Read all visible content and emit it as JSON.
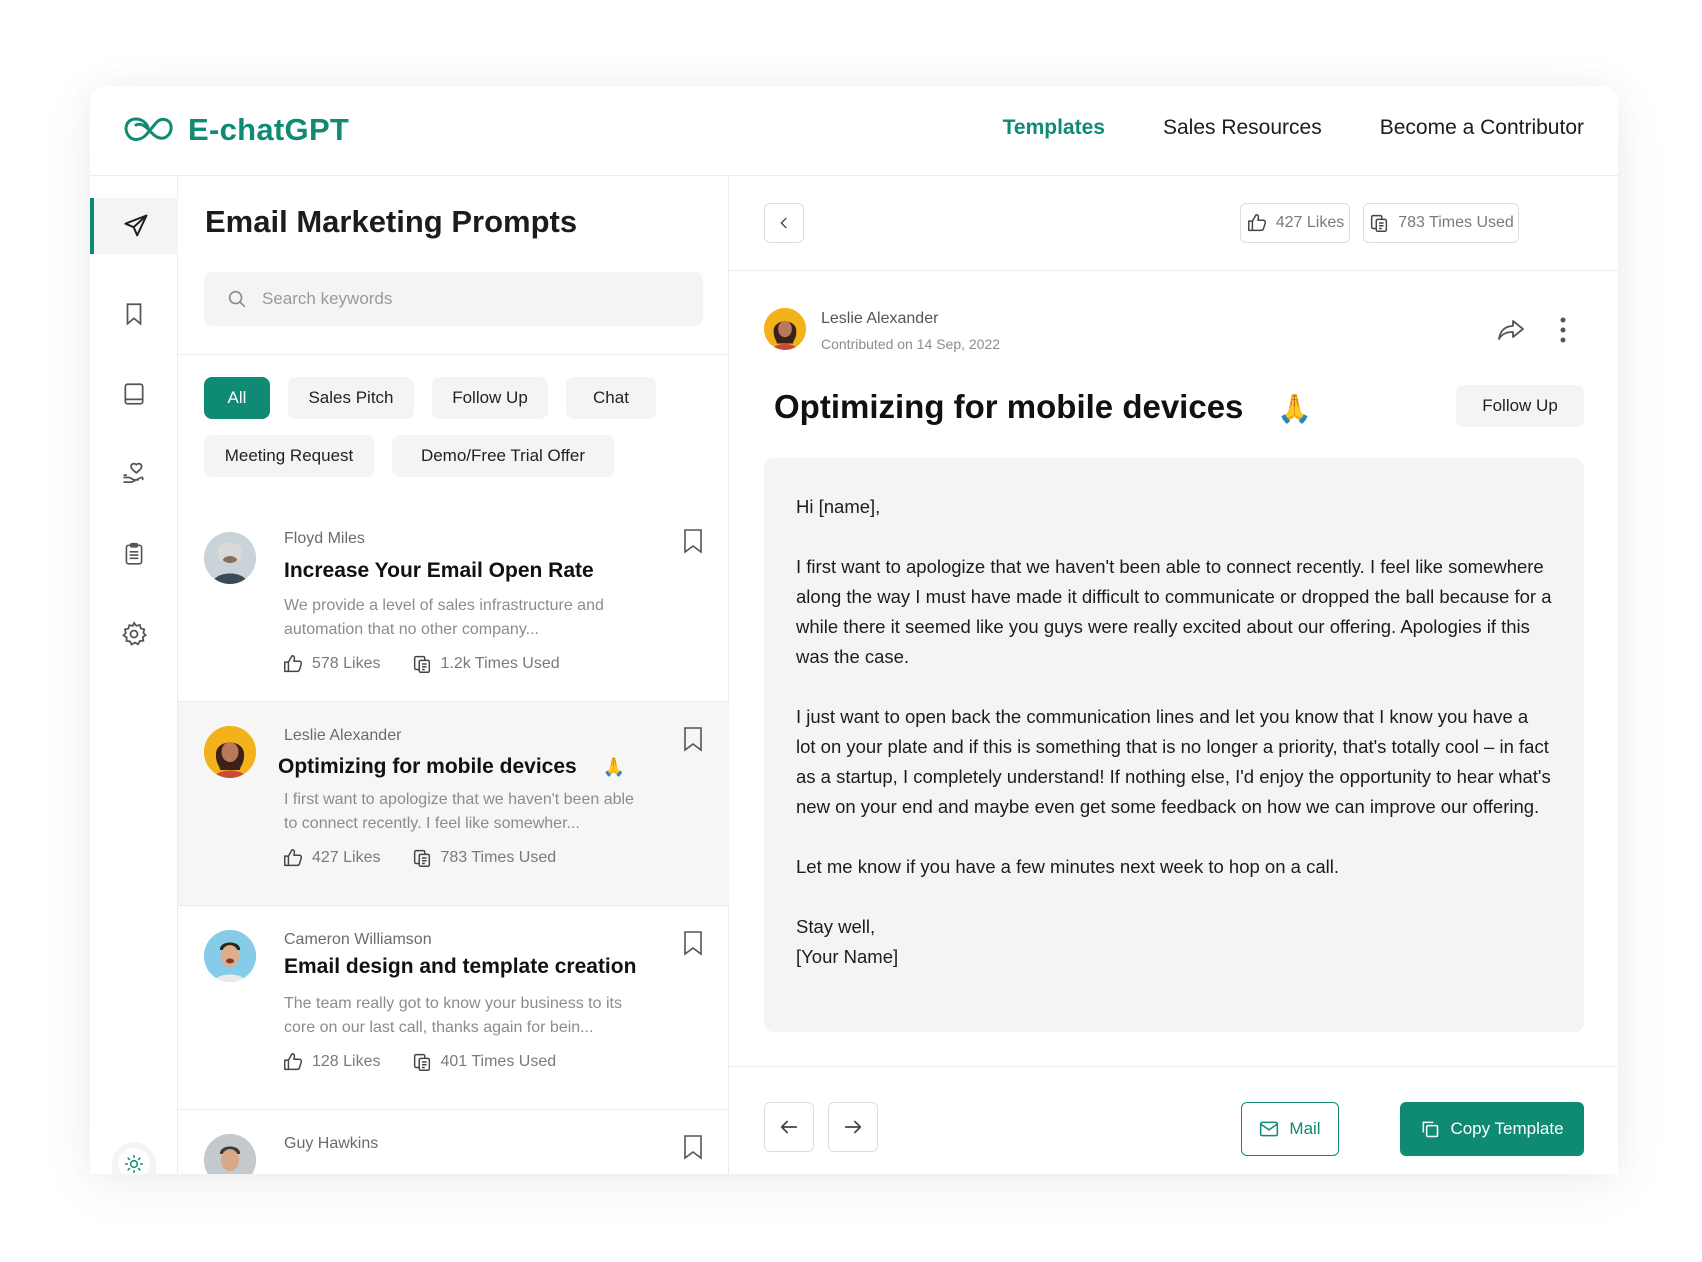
{
  "app": {
    "name": "E-chatGPT",
    "brand_color": "#0f8a73"
  },
  "nav": {
    "items": [
      "Templates",
      "Sales Resources",
      "Become a Contributor"
    ],
    "active": "Templates"
  },
  "rail": {
    "icons": [
      "send-icon",
      "bookmark-icon",
      "book-icon",
      "hand-heart-icon",
      "clipboard-icon",
      "settings-icon"
    ],
    "active": "send-icon",
    "theme": [
      "sun-icon",
      "moon-icon"
    ]
  },
  "list": {
    "title": "Email Marketing Prompts",
    "search_placeholder": "Search keywords",
    "filters": [
      "All",
      "Sales Pitch",
      "Follow Up",
      "Chat",
      "Meeting Request",
      "Demo/Free Trial Offer"
    ],
    "active_filter": "All",
    "cards": [
      {
        "author": "Floyd Miles",
        "title": "Increase Your Email Open Rate",
        "desc": "We provide a level of sales infrastructure and automation that no other company...",
        "likes": "578 Likes",
        "used": "1.2k Times Used"
      },
      {
        "author": "Leslie Alexander",
        "title": "Optimizing for mobile devices",
        "emoji": "🙏",
        "desc": "I first want to apologize that we haven't been able to connect recently. I feel like somewher...",
        "likes": "427 Likes",
        "used": "783 Times Used"
      },
      {
        "author": "Cameron Williamson",
        "title": "Email design and template creation",
        "desc": "The team really got to know your business to its core on our last call, thanks again for bein...",
        "likes": "128 Likes",
        "used": "401 Times Used"
      },
      {
        "author": "Guy Hawkins"
      }
    ]
  },
  "detail": {
    "likes": "427 Likes",
    "used": "783 Times Used",
    "author": "Leslie Alexander",
    "contributed": "Contributed on 14 Sep, 2022",
    "title": "Optimizing for mobile devices",
    "emoji": "🙏",
    "tag": "Follow Up",
    "body": {
      "greeting": "Hi [name],",
      "p1": "I first want to apologize that we haven't been able to connect recently. I feel like somewhere along the way I must have made it difficult to communicate or dropped the ball because for a while there it seemed like you guys were really excited about our offering. Apologies if this was the case.",
      "p2": "I just want to open back the communication lines and let you know that I know you have a lot on your plate and if this is something that is no longer a priority, that's totally cool – in fact as a startup, I completely understand! If nothing else, I'd enjoy the opportunity to hear what's new on your end and maybe even get some feedback on how we can improve our offering.",
      "p3": "Let me know if you have a few minutes next week to hop on a call.",
      "signoff": "Stay well,",
      "signature": "[Your Name]"
    },
    "mail_label": "Mail",
    "copy_label": "Copy Template"
  }
}
